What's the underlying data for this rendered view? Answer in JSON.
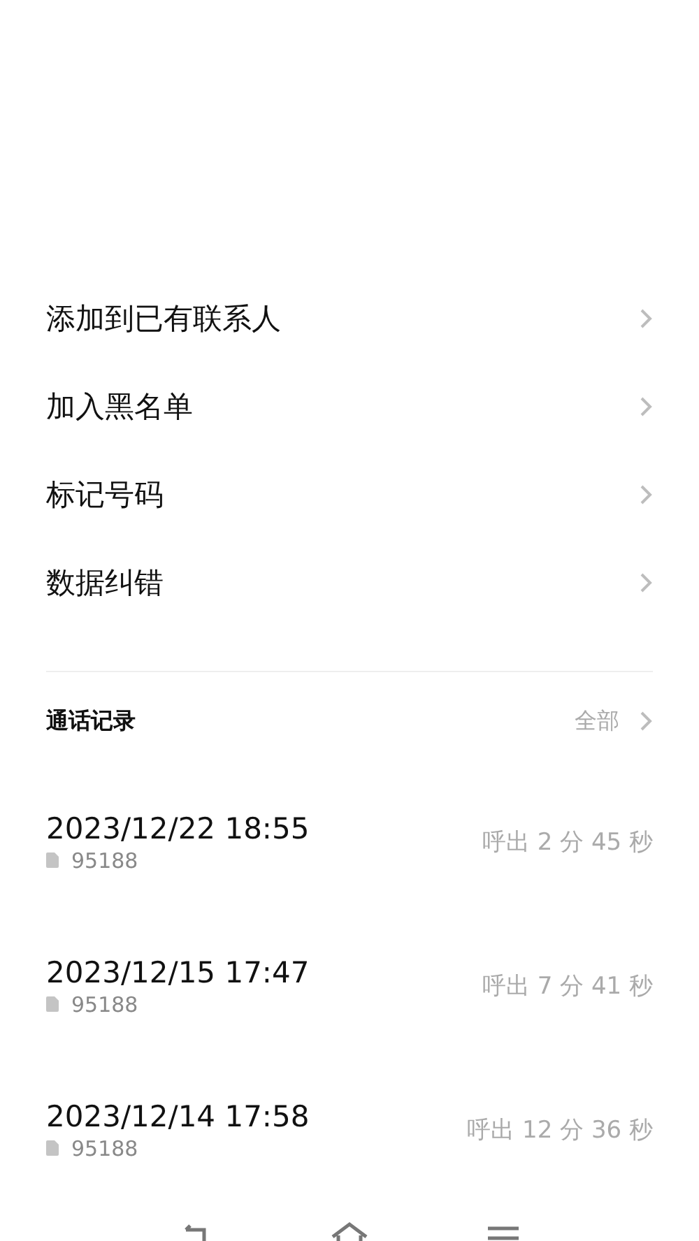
{
  "menu_items": [
    {
      "label": "添加到已有联系人"
    },
    {
      "label": "加入黑名单"
    },
    {
      "label": "标记号码"
    },
    {
      "label": "数据纠错"
    }
  ],
  "call_log": {
    "title": "通话记录",
    "all_link": "全部",
    "rows": [
      {
        "datetime": "2023/12/22 18:55",
        "number": "95188",
        "duration": "呼出 2 分 45 秒"
      },
      {
        "datetime": "2023/12/15 17:47",
        "number": "95188",
        "duration": "呼出 7 分 41 秒"
      },
      {
        "datetime": "2023/12/14 17:58",
        "number": "95188",
        "duration": "呼出 12 分 36 秒"
      }
    ]
  },
  "nav_bar": [
    {
      "kind": "back"
    },
    {
      "kind": "home"
    },
    {
      "kind": "menu"
    }
  ]
}
